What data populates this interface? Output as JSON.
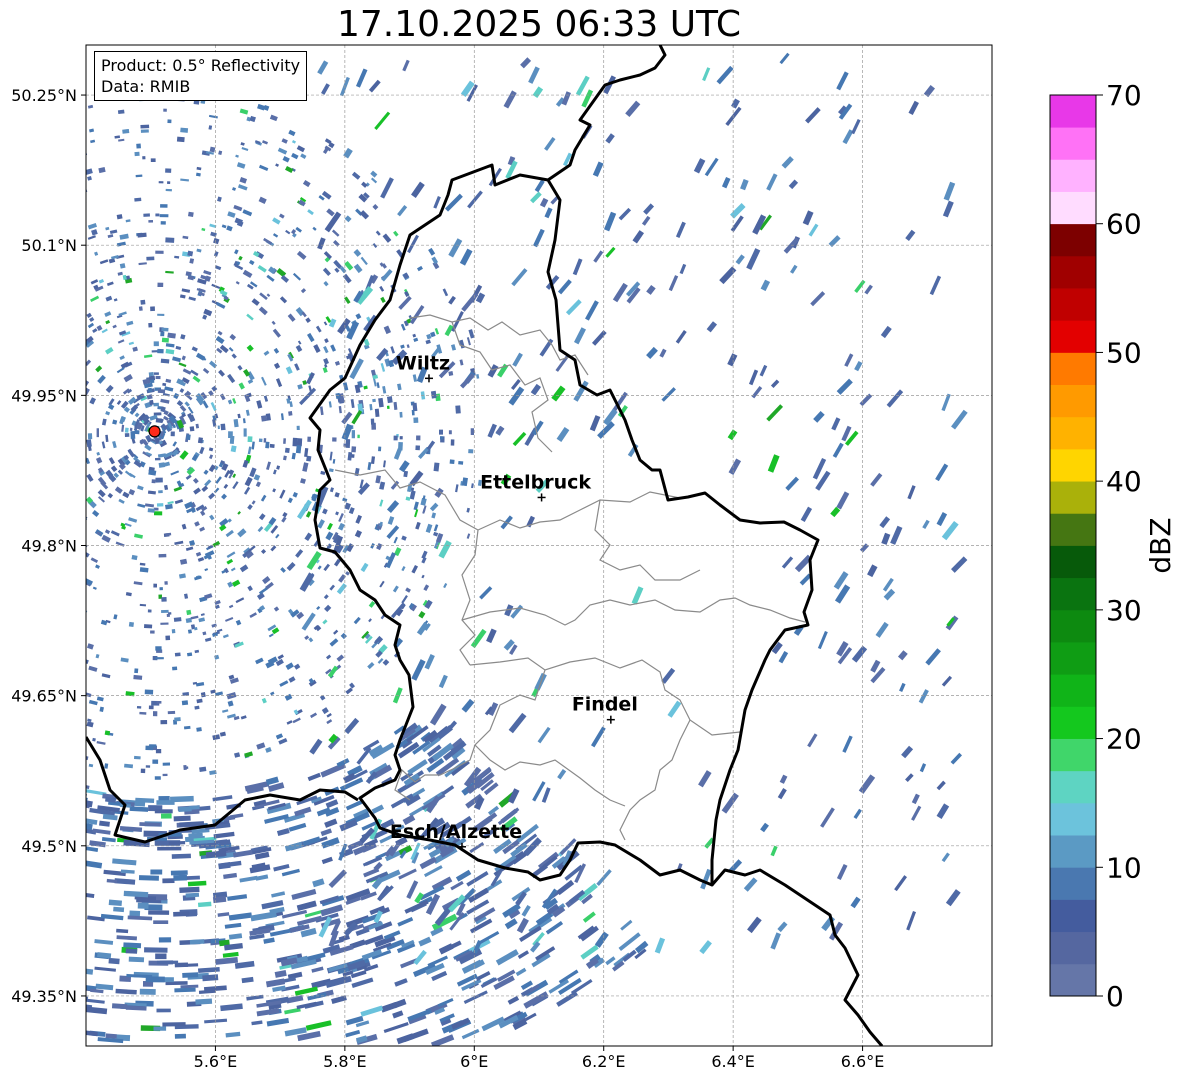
{
  "title": "17.10.2025 06:33 UTC",
  "info_box": {
    "product": "Product: 0.5° Reflectivity",
    "data_source": "Data: RMIB"
  },
  "map": {
    "lon_range": [
      5.4,
      6.8
    ],
    "lat_range": [
      49.3,
      50.3
    ],
    "lon_ticks": [
      {
        "value": 5.6,
        "label": "5.6°E"
      },
      {
        "value": 5.8,
        "label": "5.8°E"
      },
      {
        "value": 6.0,
        "label": "6°E"
      },
      {
        "value": 6.2,
        "label": "6.2°E"
      },
      {
        "value": 6.4,
        "label": "6.4°E"
      },
      {
        "value": 6.6,
        "label": "6.6°E"
      }
    ],
    "lat_ticks": [
      {
        "value": 49.35,
        "label": "49.35°N"
      },
      {
        "value": 49.5,
        "label": "49.5°N"
      },
      {
        "value": 49.65,
        "label": "49.65°N"
      },
      {
        "value": 49.8,
        "label": "49.8°N"
      },
      {
        "value": 49.95,
        "label": "49.95°N"
      },
      {
        "value": 50.1,
        "label": "50.1°N"
      },
      {
        "value": 50.25,
        "label": "50.25°N"
      }
    ],
    "cities": [
      {
        "name": "Wiltz",
        "lon": 5.93,
        "lat": 49.967
      },
      {
        "name": "Ettelbruck",
        "lon": 6.104,
        "lat": 49.848
      },
      {
        "name": "Findel",
        "lon": 6.211,
        "lat": 49.626
      },
      {
        "name": "Esch/Alzette",
        "lon": 5.981,
        "lat": 49.499
      }
    ],
    "radar_site": {
      "lon": 5.506,
      "lat": 49.914,
      "color": "#ff2a1a"
    },
    "grid": true
  },
  "colorbar": {
    "label": "dBZ",
    "min": 0,
    "max": 70,
    "step": 2.5,
    "ticks": [
      0,
      10,
      20,
      30,
      40,
      50,
      60,
      70
    ],
    "colors": [
      "#6576a8",
      "#5567a0",
      "#445c9e",
      "#4a78b0",
      "#5b9ac4",
      "#6cc3dc",
      "#5ed4c2",
      "#40d66a",
      "#14c81e",
      "#10b418",
      "#0f9d14",
      "#0d8a10",
      "#0a7410",
      "#075a0a",
      "#457612",
      "#aab10a",
      "#ffd500",
      "#ffb200",
      "#ff9a00",
      "#ff7a00",
      "#e30000",
      "#c00000",
      "#a00000",
      "#7d0000",
      "#ffdcff",
      "#ffb2ff",
      "#ff72f6",
      "#e838e8"
    ]
  }
}
